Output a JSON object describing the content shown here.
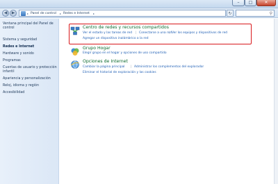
{
  "window": {
    "minimize_glyph": "–",
    "maximize_glyph": "□",
    "close_glyph": "✕"
  },
  "nav": {
    "back_glyph": "◀",
    "forward_glyph": "▶",
    "breadcrumbs": [
      "Panel de control",
      "Redes e Internet"
    ],
    "separator_glyph": "▸",
    "refresh_glyph": "↻",
    "search_placeholder": ""
  },
  "sidebar": {
    "items": [
      {
        "label": "Ventana principal del Panel de control",
        "active": false
      },
      {
        "label": "Sistema y seguridad",
        "active": false
      },
      {
        "label": "Redes e Internet",
        "active": true
      },
      {
        "label": "Hardware y sonido",
        "active": false
      },
      {
        "label": "Programas",
        "active": false
      },
      {
        "label": "Cuentas de usuario y protección infantil",
        "active": false
      },
      {
        "label": "Apariencia y personalización",
        "active": false
      },
      {
        "label": "Reloj, idioma y región",
        "active": false
      },
      {
        "label": "Accesibilidad",
        "active": false
      }
    ]
  },
  "categories": [
    {
      "title": "Centro de redes y recursos compartidos",
      "icon": "network-center-icon",
      "links": [
        "Ver el estado y las tareas de red",
        "Conectarse a una red",
        "Ver los equipos y dispositivos de red",
        "Agregar un dispositivo inalámbrico a la red"
      ]
    },
    {
      "title": "Grupo Hogar",
      "icon": "homegroup-icon",
      "links": [
        "Elegir grupo en el hogar y opciones de uso compartido"
      ]
    },
    {
      "title": "Opciones de Internet",
      "icon": "internet-options-icon",
      "links": [
        "Cambiar la página principal",
        "Administrar los complementos del explorador",
        "Eliminar el historial de exploración y las cookies"
      ]
    }
  ],
  "colors": {
    "accent_link": "#1f5fb5",
    "category_title": "#0d6a2f",
    "highlight": "#d8171a"
  }
}
